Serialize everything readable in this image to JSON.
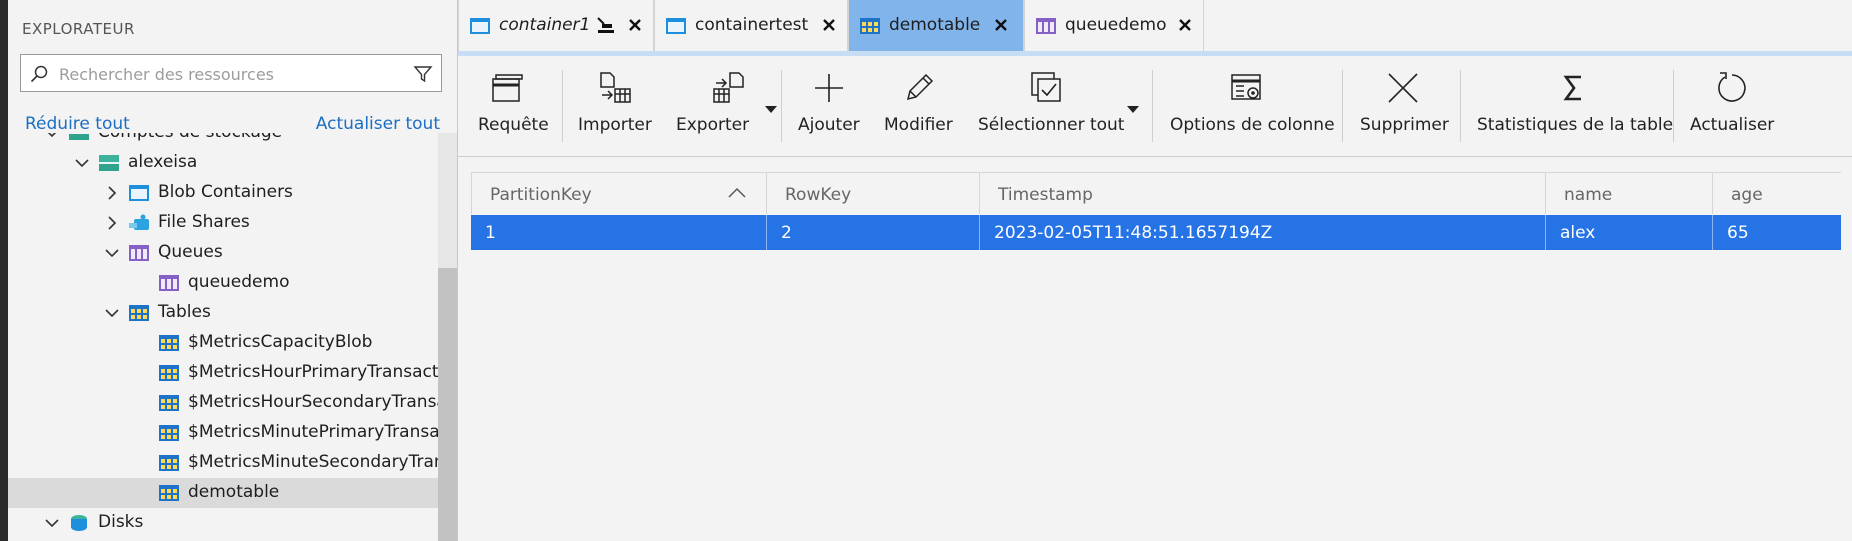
{
  "explorer": {
    "title": "EXPLORATEUR",
    "search_placeholder": "Rechercher des ressources",
    "collapse_all": "Réduire tout",
    "refresh_all": "Actualiser tout",
    "tree": [
      {
        "label": "Comptes de stockage"
      },
      {
        "label": "alexeisa"
      },
      {
        "label": "Blob Containers"
      },
      {
        "label": "File Shares"
      },
      {
        "label": "Queues"
      },
      {
        "label": "queuedemo"
      },
      {
        "label": "Tables"
      },
      {
        "label": "$MetricsCapacityBlob"
      },
      {
        "label": "$MetricsHourPrimaryTransactionsBlob"
      },
      {
        "label": "$MetricsHourSecondaryTransactionsBlob"
      },
      {
        "label": "$MetricsMinutePrimaryTransactionsBlob"
      },
      {
        "label": "$MetricsMinuteSecondaryTransactionsBlob"
      },
      {
        "label": "demotable"
      },
      {
        "label": "Disks"
      }
    ]
  },
  "tabs": [
    {
      "label": "container1"
    },
    {
      "label": "containertest"
    },
    {
      "label": "demotable"
    },
    {
      "label": "queuedemo"
    }
  ],
  "toolbar": {
    "query": "Requête",
    "import": "Importer",
    "export": "Exporter",
    "add": "Ajouter",
    "edit": "Modifier",
    "select_all": "Sélectionner tout",
    "column_options": "Options de colonne",
    "delete": "Supprimer",
    "table_stats": "Statistiques de la table",
    "refresh": "Actualiser"
  },
  "grid": {
    "columns": [
      "PartitionKey",
      "RowKey",
      "Timestamp",
      "name",
      "age"
    ],
    "rows": [
      [
        "1",
        "2",
        "2023-02-05T11:48:51.1657194Z",
        "alex",
        "65"
      ]
    ]
  },
  "colors": {
    "accent": "#2673e6",
    "active_tab": "#80b4ea",
    "link": "#1b6ec2"
  }
}
